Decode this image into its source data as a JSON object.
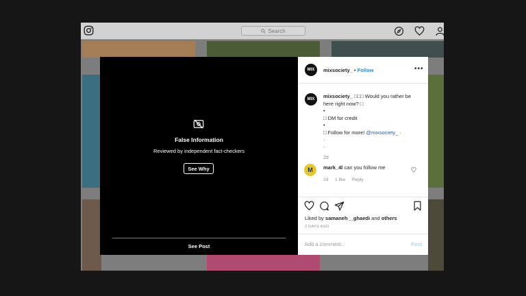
{
  "header": {
    "search_placeholder": "Search",
    "icons": [
      "instagram-logo-icon",
      "search-icon",
      "explore-compass-icon",
      "heart-icon",
      "profile-icon"
    ]
  },
  "grid": {
    "tiles": [
      {
        "name": "grid-tile-row1-col1",
        "color": "#a27d56"
      },
      {
        "name": "grid-tile-row1-col2",
        "color": "#4b5b36"
      },
      {
        "name": "grid-tile-row1-col3",
        "color": "#3e4f4e"
      },
      {
        "name": "grid-tile-row2-col1",
        "color": "#3a6f80"
      },
      {
        "name": "grid-tile-row2-col3",
        "color": "#5b6f3b"
      },
      {
        "name": "grid-tile-row3-col1",
        "color": "#6e5a4a"
      },
      {
        "name": "grid-tile-row3-col2",
        "color": "#b04a70"
      },
      {
        "name": "grid-tile-row3-col3",
        "color": "#4d4a3a"
      }
    ]
  },
  "overlay": {
    "icon": "eye-slash-icon",
    "title": "False Information",
    "subtitle": "Reviewed by independent fact-checkers",
    "see_why": "See Why",
    "see_post": "See Post"
  },
  "post": {
    "avatar_text": "MIX",
    "username": "mixsociety_",
    "separator": "•",
    "follow": "Follow",
    "more": "•••",
    "caption": {
      "username": "mixsociety_",
      "line1": "□□□ Would you rather be here right now? □",
      "dot1": "•",
      "line2": "□ DM for credit",
      "dot2": "•",
      "line3": "□ Follow for more! ",
      "mention": "@mixsociety_",
      "mention_suffix": " ·",
      "dot3": "·",
      "dot4": "·"
    },
    "caption_time": "2d",
    "comment": {
      "username": "mark_4l",
      "text": "can you follow me",
      "time": "2d",
      "likes": "1 like",
      "reply": "Reply"
    },
    "liked_by_prefix": "Liked by ",
    "liked_by_user": "samaneh__ghaedi",
    "liked_by_and": " and ",
    "liked_by_others": "others",
    "date": "2 DAYS AGO",
    "add_comment_placeholder": "Add a comment...",
    "post_label": "Post"
  },
  "colors": {
    "follow_blue": "#2a8ad8",
    "mention_blue": "#2a5d9c",
    "modal_black": "#000000",
    "post_disabled": "#b3d4f3"
  }
}
